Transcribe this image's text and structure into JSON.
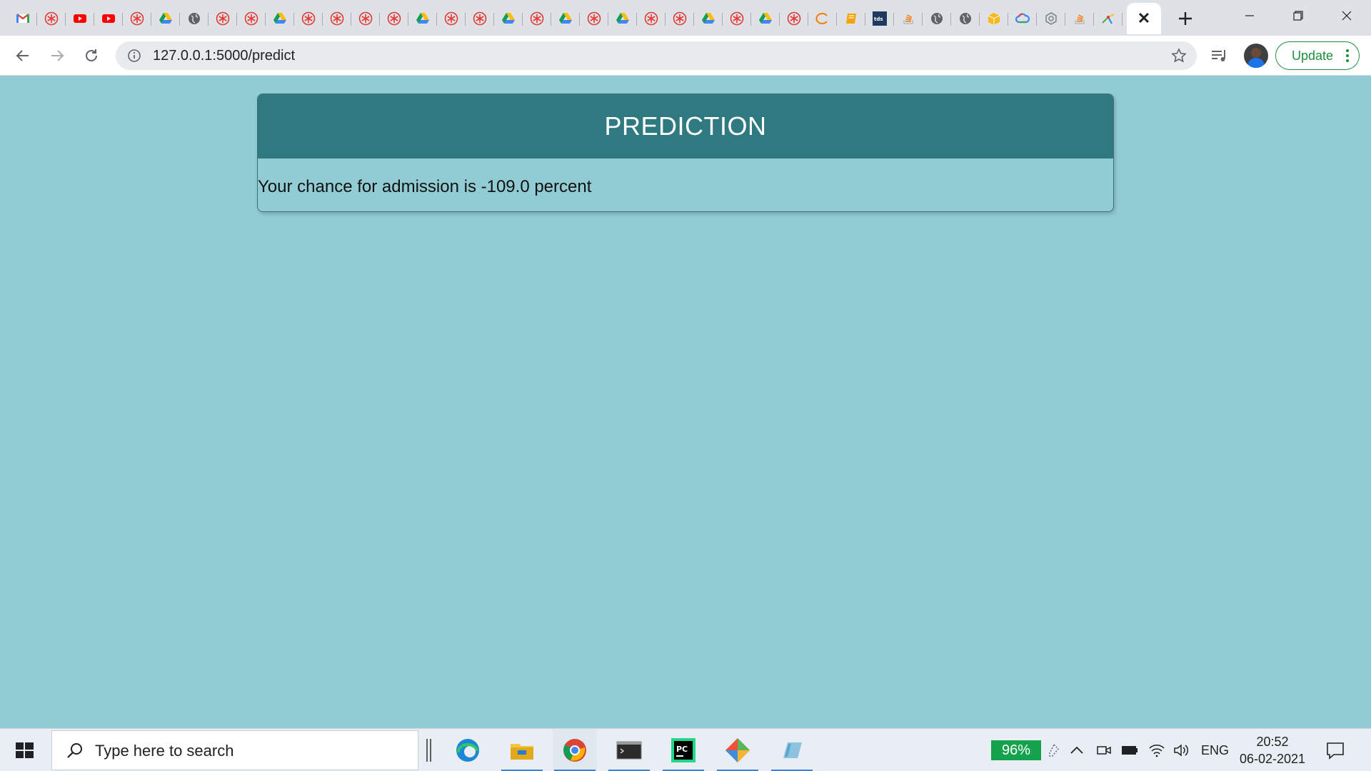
{
  "browser": {
    "tab_favicons": [
      "gmail-icon",
      "asterisk-icon",
      "youtube-icon",
      "youtube-icon",
      "asterisk-icon",
      "drive-icon",
      "globe-icon",
      "asterisk-icon",
      "asterisk-icon",
      "drive-icon",
      "asterisk-icon",
      "asterisk-icon",
      "asterisk-icon",
      "asterisk-icon",
      "drive-icon",
      "asterisk-icon",
      "asterisk-icon",
      "drive-icon",
      "asterisk-icon",
      "drive-icon",
      "asterisk-icon",
      "drive-icon",
      "asterisk-icon",
      "asterisk-icon",
      "drive-icon",
      "asterisk-icon",
      "drive-icon",
      "asterisk-icon",
      "ring-icon",
      "book-icon",
      "tds-icon",
      "stack-icon",
      "globe-icon",
      "globe-icon",
      "box-icon",
      "cloud-icon",
      "gear-icon",
      "stack-icon",
      "sparkle-icon"
    ],
    "tds_label": "tds",
    "address": "127.0.0.1:5000/predict",
    "update_label": "Update"
  },
  "page": {
    "title": "PREDICTION",
    "result_text": "Your chance for admission is -109.0 percent"
  },
  "taskbar": {
    "search_placeholder": "Type here to search",
    "battery_percent": "96%",
    "language": "ENG",
    "time": "20:52",
    "date": "06-02-2021"
  },
  "colors": {
    "page_background": "#91ccd5",
    "card_header": "#2f7980",
    "update_green": "#1e8e3e",
    "battery_green": "#14a34c"
  }
}
